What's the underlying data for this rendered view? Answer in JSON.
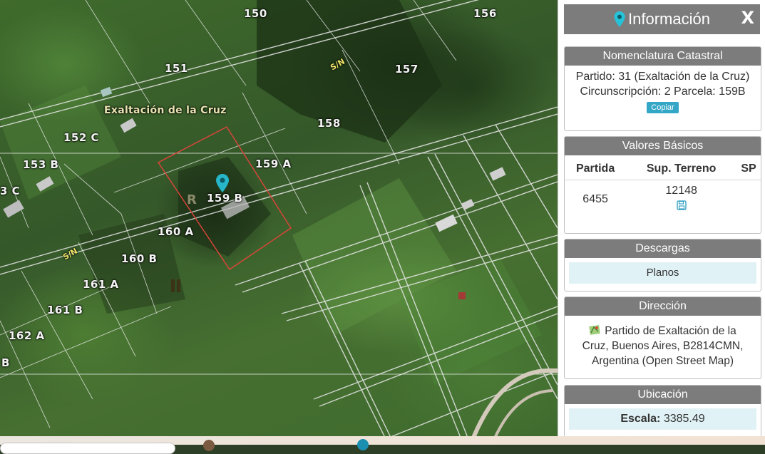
{
  "map": {
    "locality": "Exaltación de la Cruz",
    "street_labels": [
      "S/N",
      "S/N"
    ],
    "lots": [
      "150",
      "156",
      "151",
      "157",
      "158",
      "152 C",
      "153 B",
      "159 A",
      "3 C",
      "159 B",
      "160 A",
      "160 B",
      "161 A",
      "161 B",
      "162 A",
      "B"
    ],
    "accent_parcel_color": "#e0443a",
    "pin_color": "#26b5c9"
  },
  "panel": {
    "title": "Información",
    "close_label": "X",
    "nomenclatura": {
      "heading": "Nomenclatura Catastral",
      "line1": "Partido: 31 (Exaltación de la Cruz)",
      "line2": "Circunscripción: 2 Parcela: 159B",
      "copy_label": "Copiar"
    },
    "valores": {
      "heading": "Valores Básicos",
      "columns": [
        "Partida",
        "Sup. Terreno",
        "SP"
      ],
      "row": [
        "6455",
        "12148",
        ""
      ]
    },
    "descargas": {
      "heading": "Descargas",
      "planos_label": "Planos"
    },
    "direccion": {
      "heading": "Dirección",
      "line1": "Partido de Exaltación de la",
      "line2": "Cruz, Buenos Aires, B2814CMN,",
      "line3": "Argentina (Open Street Map)"
    },
    "ubicacion": {
      "heading": "Ubicación",
      "escala_label": "Escala:",
      "escala_value": "3385.49"
    },
    "colors": {
      "header_gray": "#7c7c7c",
      "link_bg": "#e0f2f6",
      "copy_button": "#35a7c6"
    }
  }
}
